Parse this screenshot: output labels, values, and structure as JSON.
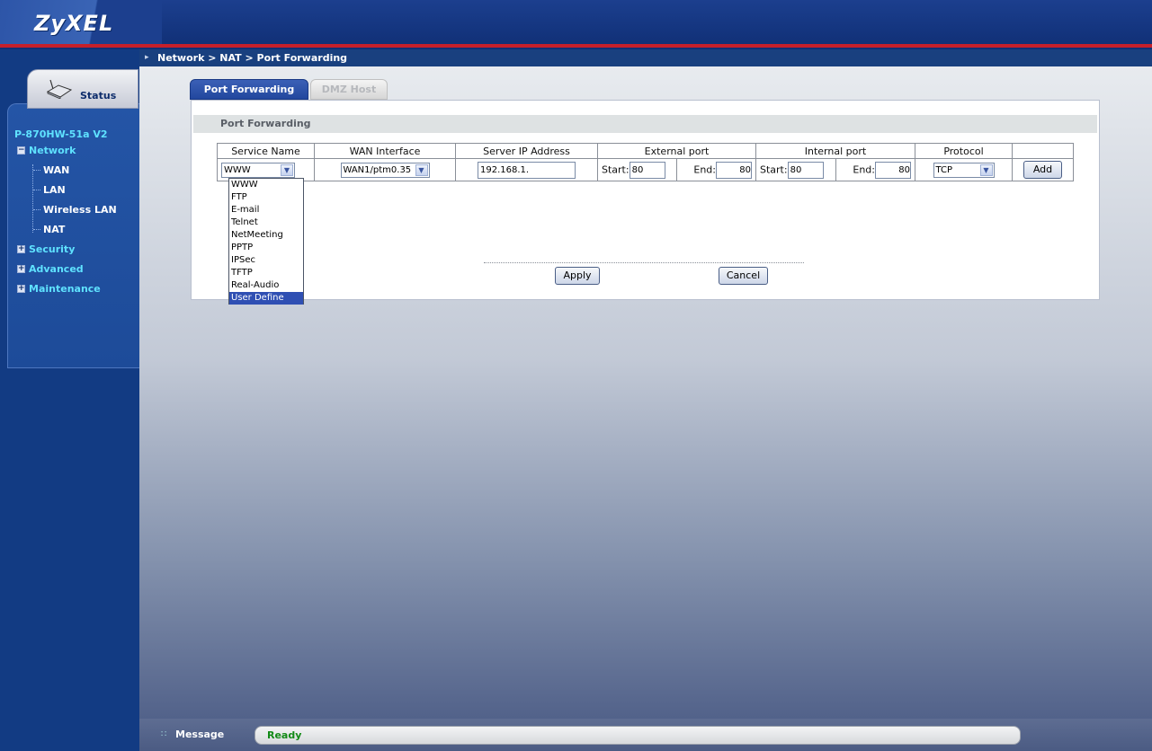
{
  "header": {
    "logo": "ZyXEL"
  },
  "breadcrumb": "Network > NAT > Port Forwarding",
  "nav": {
    "status_tab": "Status",
    "model": "P-870HW-51a V2",
    "items": [
      {
        "label": "Network",
        "toggle": "−"
      },
      {
        "label": "WAN"
      },
      {
        "label": "LAN"
      },
      {
        "label": "Wireless LAN"
      },
      {
        "label": "NAT"
      },
      {
        "label": "Security",
        "toggle": "+"
      },
      {
        "label": "Advanced",
        "toggle": "+"
      },
      {
        "label": "Maintenance",
        "toggle": "+"
      }
    ]
  },
  "tabs": [
    "Port Forwarding",
    "DMZ Host"
  ],
  "panel": {
    "title": "Port Forwarding",
    "columns": [
      "Service Name",
      "WAN Interface",
      "Server IP Address",
      "External port",
      "Internal port",
      "Protocol"
    ],
    "row": {
      "service": "WWW",
      "wan": "WAN1/ptm0.35",
      "server_ip": "192.168.1.",
      "start_label": "Start:",
      "end_label": "End:",
      "ext_start": "80",
      "ext_end": "80",
      "int_start": "80",
      "int_end": "80",
      "protocol": "TCP",
      "add": "Add"
    },
    "service_options": [
      "WWW",
      "FTP",
      "E-mail",
      "Telnet",
      "NetMeeting",
      "PPTP",
      "IPSec",
      "TFTP",
      "Real-Audio",
      "User Define"
    ],
    "apply": "Apply",
    "cancel": "Cancel"
  },
  "statusbar": {
    "label": "Message",
    "text": "Ready"
  },
  "colors": {
    "accent": "#22479e",
    "brand_red": "#c61f2a",
    "nav_link": "#5fe2ff",
    "ready": "#128a16"
  }
}
